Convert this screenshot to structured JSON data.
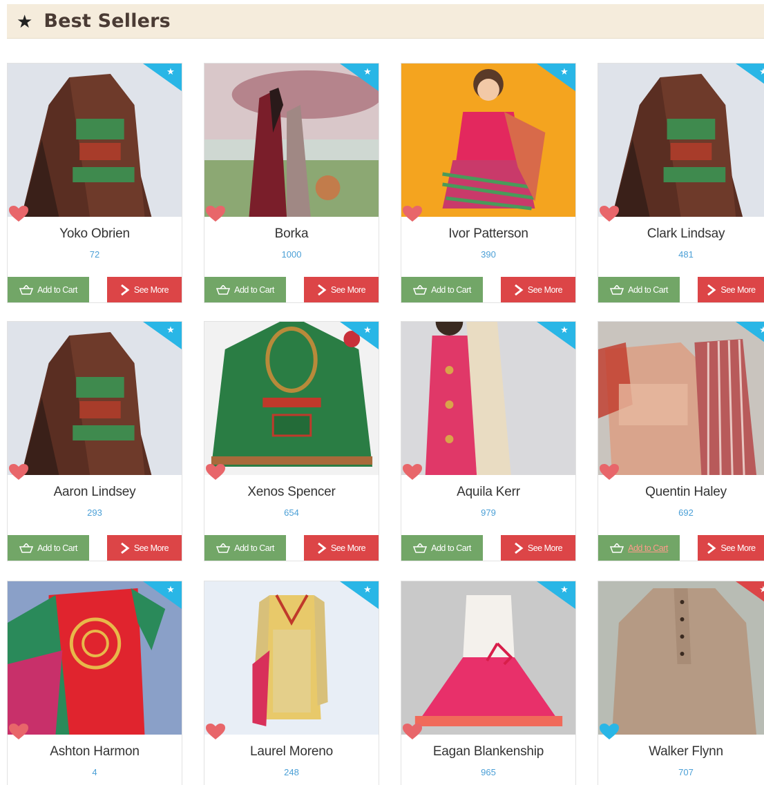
{
  "section": {
    "title": "Best Sellers",
    "icon": "star-icon"
  },
  "buttons": {
    "add_to_cart": "Add to Cart",
    "see_more": "See More"
  },
  "colors": {
    "cart": "#72a667",
    "more": "#dc4547",
    "ribbon": "#29b6e6",
    "heart": "#e8666a",
    "price": "#4a9fd6",
    "header_bg": "#f5ecdc"
  },
  "products": [
    {
      "name": "Yoko Obrien",
      "price": "72"
    },
    {
      "name": "Borka",
      "price": "1000"
    },
    {
      "name": "Ivor Patterson",
      "price": "390"
    },
    {
      "name": "Clark Lindsay",
      "price": "481"
    },
    {
      "name": "Aaron Lindsey",
      "price": "293"
    },
    {
      "name": "Xenos Spencer",
      "price": "654"
    },
    {
      "name": "Aquila Kerr",
      "price": "979"
    },
    {
      "name": "Quentin Haley",
      "price": "692"
    },
    {
      "name": "Ashton Harmon",
      "price": "4"
    },
    {
      "name": "Laurel Moreno",
      "price": "248"
    },
    {
      "name": "Eagan Blankenship",
      "price": "965"
    },
    {
      "name": "Walker Flynn",
      "price": "707"
    }
  ]
}
